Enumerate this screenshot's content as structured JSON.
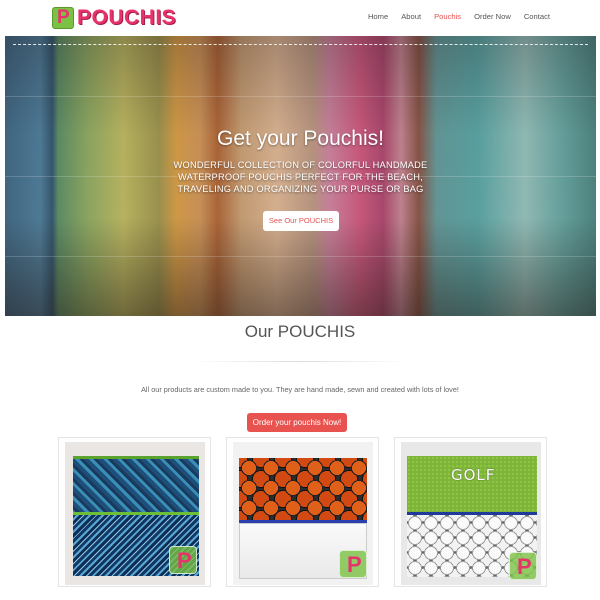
{
  "brand": {
    "logo_letter": "P",
    "name": "POUCHIS",
    "color": "#e8326b",
    "logo_bg": "#7bc143"
  },
  "nav": {
    "items": [
      {
        "label": "Home",
        "active": false
      },
      {
        "label": "About",
        "active": false
      },
      {
        "label": "Pouchis",
        "active": true
      },
      {
        "label": "Order Now",
        "active": false
      },
      {
        "label": "Contact",
        "active": false
      }
    ],
    "active_color": "#e8524f"
  },
  "hero": {
    "title": "Get your Pouchis!",
    "subtitle": "WONDERFUL COLLECTION OF COLORFUL HANDMADE WATERPROOF POUCHIS PERFECT FOR THE BEACH, TRAVELING AND ORGANIZING YOUR PURSE OR BAG",
    "button_label": "See Our POUCHIS"
  },
  "section": {
    "title": "Our POUCHIS",
    "intro": "All our products are custom made to you. They are hand made, sewn and created with lots of love!",
    "order_button": "Order your pouchis Now!",
    "accent_color": "#e8524f"
  },
  "products": [
    {
      "icon": "blue-pattern-pouch-image"
    },
    {
      "icon": "basketball-pouch-image"
    },
    {
      "icon": "golf-pouch-image",
      "embroidery": "GOLF"
    }
  ]
}
